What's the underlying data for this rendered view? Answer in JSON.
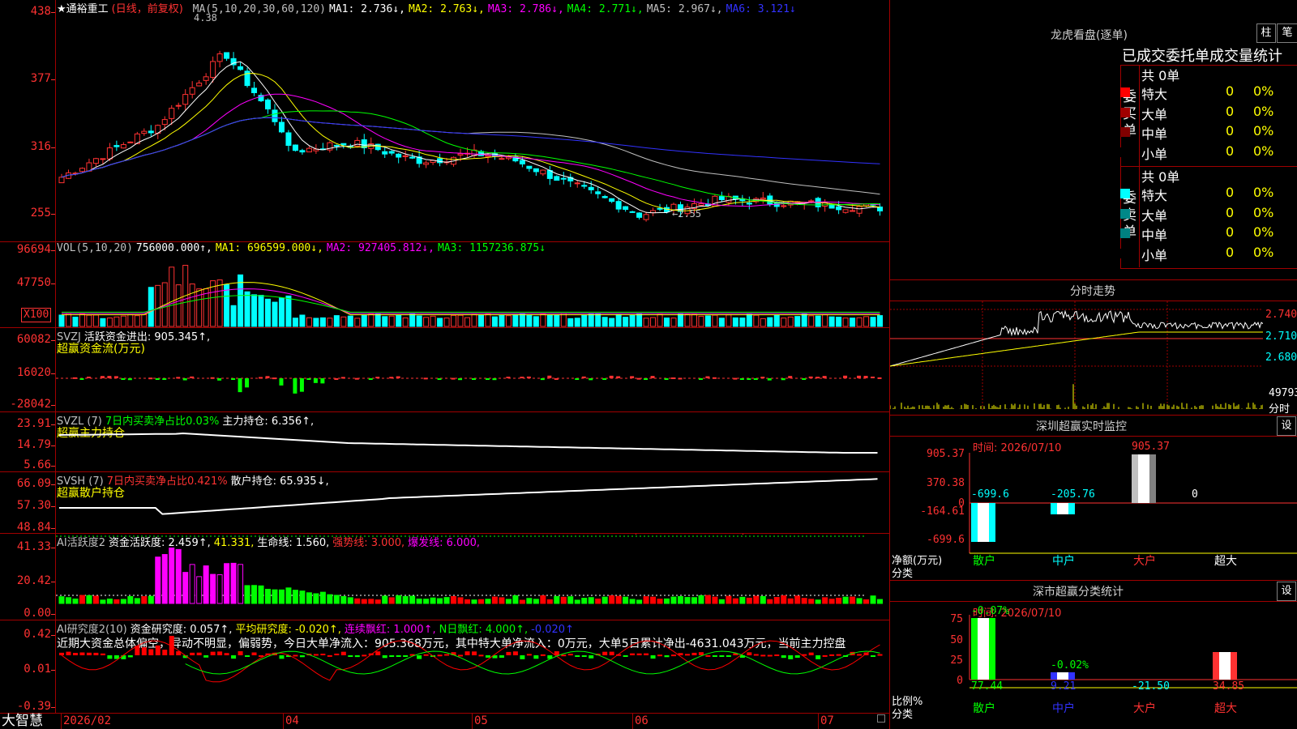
{
  "stock": {
    "name": "★通裕重工",
    "mode": "(日线，前复权)",
    "ma_header": [
      {
        "text": "MA(5,10,20,30,60,120)",
        "color": "#c0c0c0"
      },
      {
        "text": "MA1: 2.736↓,",
        "color": "#ffffff"
      },
      {
        "text": "MA2: 2.763↓,",
        "color": "#ffff00"
      },
      {
        "text": "MA3: 2.786↓,",
        "color": "#ff00ff"
      },
      {
        "text": "MA4: 2.771↓,",
        "color": "#00ff00"
      },
      {
        "text": "MA5: 2.967↓,",
        "color": "#c0c0c0"
      },
      {
        "text": "MA6: 3.121↓",
        "color": "#3232ff"
      }
    ],
    "high_label": "4.38",
    "low_label": "←2.55",
    "y_labels": [
      "438",
      "377",
      "316",
      "255"
    ]
  },
  "vol": {
    "header": [
      {
        "text": "VOL(5,10,20)",
        "color": "#c0c0c0"
      },
      {
        "text": "756000.000↑,",
        "color": "#ffffff"
      },
      {
        "text": "MA1: 696599.000↓,",
        "color": "#ffff00"
      },
      {
        "text": "MA2: 927405.812↓,",
        "color": "#ff00ff"
      },
      {
        "text": "MA3: 1157236.875↓",
        "color": "#00ff00"
      }
    ],
    "y_labels": [
      "96694",
      "47750"
    ],
    "unit": "X100"
  },
  "svzj": {
    "header": [
      {
        "text": "SVZJ",
        "color": "#c0c0c0"
      },
      {
        "text": "活跃资金进出: 905.345↑,",
        "color": "#ffffff"
      }
    ],
    "sub": "超赢资金流(万元)",
    "y_labels": [
      "60082",
      "16020",
      "-28042"
    ]
  },
  "svzl": {
    "header": [
      {
        "text": "SVZL (7)",
        "color": "#c0c0c0"
      },
      {
        "text": "7日内买卖净占比0.03%",
        "color": "#00ff00"
      },
      {
        "text": "主力持仓: 6.356↑,",
        "color": "#ffffff"
      }
    ],
    "sub": "超赢主力持仓",
    "y_labels": [
      "23.91",
      "14.79",
      "5.66"
    ]
  },
  "svsh": {
    "header": [
      {
        "text": "SVSH (7)",
        "color": "#c0c0c0"
      },
      {
        "text": "7日内买卖净占比0.421%",
        "color": "#ff3232"
      },
      {
        "text": "散户持仓: 65.935↓,",
        "color": "#ffffff"
      }
    ],
    "sub": "超赢散户持仓",
    "y_labels": [
      "66.09",
      "57.30",
      "48.84"
    ]
  },
  "ai_active": {
    "header": [
      {
        "text": "AI活跃度2",
        "color": "#c0c0c0"
      },
      {
        "text": "资金活跃度: 2.459↑,",
        "color": "#ffffff"
      },
      {
        "text": "41.331,",
        "color": "#ffff00"
      },
      {
        "text": "生命线: 1.560,",
        "color": "#ffffff"
      },
      {
        "text": "强势线: 3.000,",
        "color": "#ff3232"
      },
      {
        "text": "爆发线: 6.000,",
        "color": "#ff00ff"
      }
    ],
    "y_labels": [
      "41.33",
      "20.42",
      "0.00"
    ]
  },
  "ai_research": {
    "header": [
      {
        "text": "AI研究度2(10)",
        "color": "#c0c0c0"
      },
      {
        "text": "资金研究度: 0.057↑,",
        "color": "#ffffff"
      },
      {
        "text": "平均研究度: -0.020↑,",
        "color": "#ffff00"
      },
      {
        "text": "连续飘红: 1.000↑,",
        "color": "#ff00ff"
      },
      {
        "text": "N日飘红: 4.000↑,",
        "color": "#00ff00"
      },
      {
        "text": "-0.020↑",
        "color": "#3232ff"
      }
    ],
    "comment": "近期大资金总体偏空，异动不明显，偏弱势，今日大单净流入：905.368万元，其中特大单净流入：0万元，大单5日累计净出-4631.043万元，当前主力控盘",
    "y_labels": [
      "0.42",
      "0.01",
      "-0.39"
    ]
  },
  "xaxis": {
    "brand": "大智慧",
    "labels": [
      "2026/02",
      "04",
      "05",
      "06",
      "07"
    ]
  },
  "dragon": {
    "title": "龙虎看盘(逐单)",
    "btn_col": "柱",
    "btn_pen": "笔",
    "head": "已成交委托单成交量统计",
    "buy_label": "委买单",
    "sell_label": "委卖单",
    "buy_total": "共 0单",
    "sell_total": "共 0单",
    "buy_rows": [
      {
        "name": "特大",
        "val": "0",
        "pct": "0%",
        "color": "#ff0000"
      },
      {
        "name": "大单",
        "val": "0",
        "pct": "0%",
        "color": "#a00000"
      },
      {
        "name": "中单",
        "val": "0",
        "pct": "0%",
        "color": "#800000"
      },
      {
        "name": "小单",
        "val": "0",
        "pct": "0%",
        "color": "#000000"
      }
    ],
    "sell_rows": [
      {
        "name": "特大",
        "val": "0",
        "pct": "0%",
        "color": "#00ffff"
      },
      {
        "name": "大单",
        "val": "0",
        "pct": "0%",
        "color": "#008888"
      },
      {
        "name": "中单",
        "val": "0",
        "pct": "0%",
        "color": "#008080"
      },
      {
        "name": "小单",
        "val": "0",
        "pct": "0%",
        "color": "#000000"
      }
    ]
  },
  "intraday": {
    "title": "分时走势",
    "prices": [
      "2.740",
      "2.710",
      "2.680"
    ],
    "vol_label": "49793",
    "time_label": "分时"
  },
  "sz_monitor": {
    "title": "深圳超赢实时监控",
    "btn": "设",
    "time": "时间: 2026/07/10",
    "y_labels": [
      "905.37",
      "370.38",
      "0",
      "-164.61",
      "-699.6"
    ],
    "values": [
      {
        "label": "-699.6",
        "color": "#00ffff"
      },
      {
        "label": "-205.76",
        "color": "#00ffff"
      },
      {
        "label": "905.37",
        "color": "#ff3232"
      },
      {
        "label": "0",
        "color": "#ffffff"
      }
    ],
    "axis_label_1": "净额(万元)",
    "axis_label_2": "分类",
    "cats": [
      {
        "t": "散户",
        "c": "#00ff00"
      },
      {
        "t": "中户",
        "c": "#00ffff"
      },
      {
        "t": "大户",
        "c": "#ff3232"
      },
      {
        "t": "超大",
        "c": "#ffffff"
      }
    ]
  },
  "sz_stats": {
    "title": "深市超赢分类统计",
    "btn": "设",
    "time": "时间: 2026/07/10",
    "y_labels": [
      "75",
      "50",
      "25",
      "0"
    ],
    "top_labels": [
      {
        "t": "-0.07%",
        "c": "#00ff00"
      },
      {
        "t": "-0.02%",
        "c": "#00ff00"
      }
    ],
    "axis_label_1": "比例%",
    "axis_label_2": "分类",
    "values": [
      {
        "t": "77.44",
        "c": "#00ff00"
      },
      {
        "t": "9.21",
        "c": "#3232ff"
      },
      {
        "t": "-21.50",
        "c": "#00ffff"
      },
      {
        "t": "34.85",
        "c": "#ff3232"
      }
    ],
    "cats": [
      {
        "t": "散户",
        "c": "#00ff00"
      },
      {
        "t": "中户",
        "c": "#3232ff"
      },
      {
        "t": "大户",
        "c": "#ff3232"
      },
      {
        "t": "超大",
        "c": "#ff3232"
      }
    ]
  }
}
